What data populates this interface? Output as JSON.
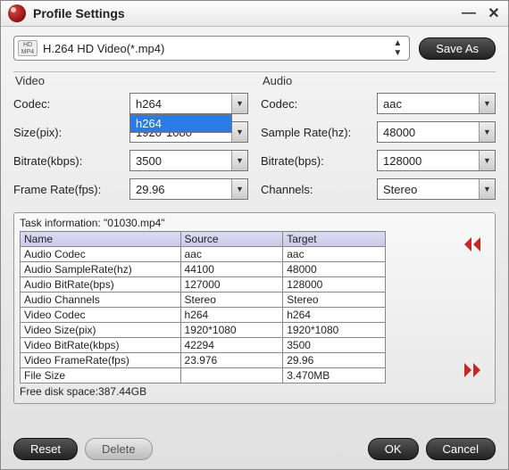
{
  "window": {
    "title": "Profile Settings"
  },
  "profile": {
    "icon_label": "HD\nMP4",
    "name": "H.264 HD Video(*.mp4)",
    "save_as": "Save As"
  },
  "video": {
    "section": "Video",
    "codec_label": "Codec:",
    "codec": "h264",
    "codec_option": "h264",
    "size_label": "Size(pix):",
    "size": "1920*1080",
    "bitrate_label": "Bitrate(kbps):",
    "bitrate": "3500",
    "framerate_label": "Frame Rate(fps):",
    "framerate": "29.96"
  },
  "audio": {
    "section": "Audio",
    "codec_label": "Codec:",
    "codec": "aac",
    "samplerate_label": "Sample Rate(hz):",
    "samplerate": "48000",
    "bitrate_label": "Bitrate(bps):",
    "bitrate": "128000",
    "channels_label": "Channels:",
    "channels": "Stereo"
  },
  "task": {
    "header": "Task information: \"01030.mp4\"",
    "columns": {
      "name": "Name",
      "source": "Source",
      "target": "Target"
    },
    "rows": [
      {
        "name": "Audio Codec",
        "source": "aac",
        "target": "aac"
      },
      {
        "name": "Audio SampleRate(hz)",
        "source": "44100",
        "target": "48000"
      },
      {
        "name": "Audio BitRate(bps)",
        "source": "127000",
        "target": "128000"
      },
      {
        "name": "Audio Channels",
        "source": "Stereo",
        "target": "Stereo"
      },
      {
        "name": "Video Codec",
        "source": "h264",
        "target": "h264"
      },
      {
        "name": "Video Size(pix)",
        "source": "1920*1080",
        "target": "1920*1080"
      },
      {
        "name": "Video BitRate(kbps)",
        "source": "42294",
        "target": "3500"
      },
      {
        "name": "Video FrameRate(fps)",
        "source": "23.976",
        "target": "29.96"
      },
      {
        "name": "File Size",
        "source": "",
        "target": "3.470MB"
      }
    ],
    "free_disk": "Free disk space:387.44GB"
  },
  "footer": {
    "reset": "Reset",
    "delete": "Delete",
    "ok": "OK",
    "cancel": "Cancel"
  }
}
